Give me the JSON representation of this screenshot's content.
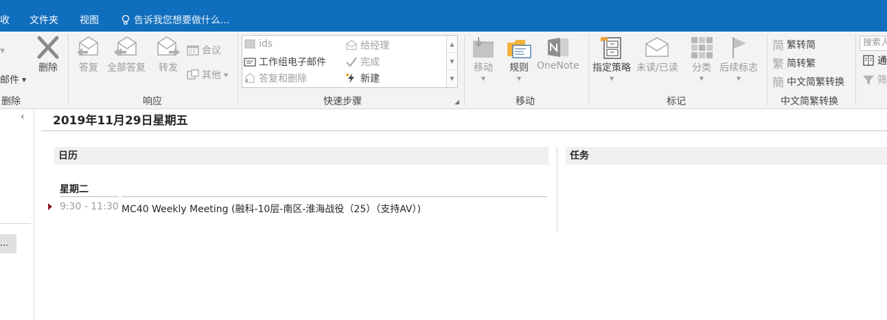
{
  "menubar": {
    "tabs": [
      "收",
      "文件夹",
      "视图"
    ],
    "tell_me": "告诉我您想要做什么..."
  },
  "ribbon": {
    "delete_group": {
      "partial_label": "邮件",
      "delete": "删除",
      "group": "删除"
    },
    "respond": {
      "reply": "答复",
      "reply_all": "全部答复",
      "forward": "转发",
      "meeting": "会议",
      "more": "其他",
      "group": "响应"
    },
    "quick_steps": {
      "items": [
        {
          "label": "ids",
          "enabled": false
        },
        {
          "label": "给经理",
          "enabled": false
        },
        {
          "label": "工作组电子邮件",
          "enabled": true
        },
        {
          "label": "完成",
          "enabled": false
        },
        {
          "label": "答复和删除",
          "enabled": false
        },
        {
          "label": "新建",
          "enabled": true
        }
      ],
      "group": "快速步骤"
    },
    "move": {
      "move": "移动",
      "rules": "规则",
      "onenote": "OneNote",
      "group": "移动"
    },
    "tags": {
      "policy": "指定策略",
      "unread": "未读/已读",
      "categorize": "分类",
      "followup": "后续标志",
      "group": "标记"
    },
    "chinese": {
      "t2s": "繁转简",
      "s2t": "简转繁",
      "convert": "中文简繁转换",
      "group": "中文简繁转换"
    },
    "find": {
      "search_placeholder": "搜索人",
      "address": "通",
      "filter": "筛"
    }
  },
  "leftpane": {
    "button": "...",
    "collapse_glyph": "‹"
  },
  "main": {
    "date_title": "2019年11月29日星期五",
    "calendar_header": "日历",
    "tasks_header": "任务",
    "day": "星期二",
    "event": {
      "time": "9:30 - 11:30",
      "subject": "MC40 Weekly Meeting (融科-10层-南区-淮海战役（25）（支持AV）)"
    }
  },
  "icons": [
    "lightbulb-icon",
    "delete-icon",
    "reply-icon",
    "reply-all-icon",
    "forward-icon",
    "meeting-icon",
    "more-icon",
    "move-icon",
    "rules-icon",
    "onenote-icon",
    "policy-icon",
    "unread-icon",
    "categorize-icon",
    "flag-icon",
    "address-book-icon",
    "filter-icon"
  ],
  "colors": {
    "menubar": "#106ebe",
    "ribbon": "#f3f3f3",
    "event_marker": "#8b1a1a"
  }
}
